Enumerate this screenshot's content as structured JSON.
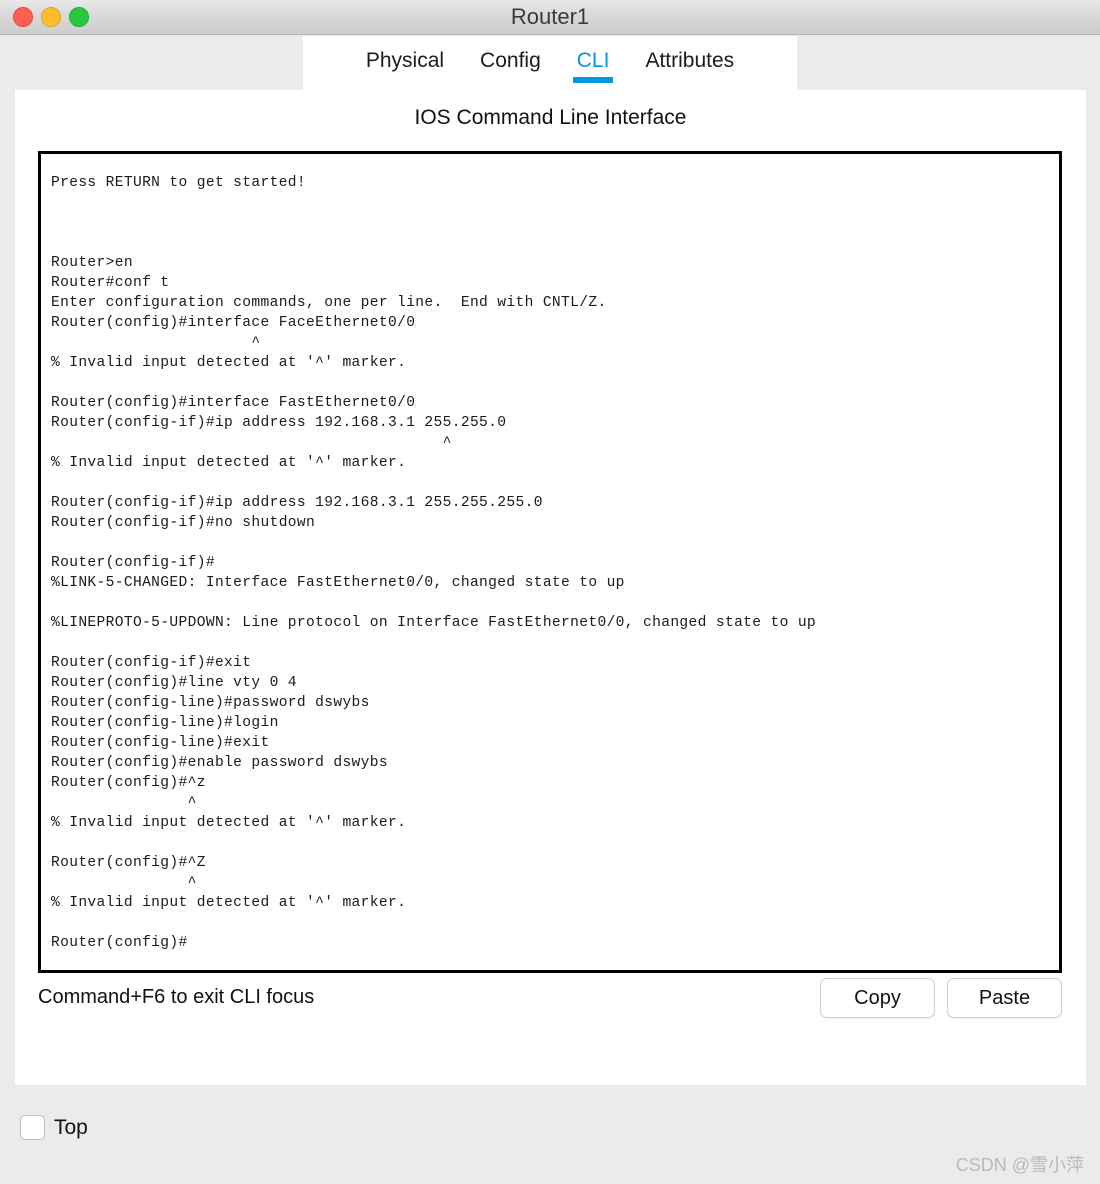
{
  "window": {
    "title": "Router1",
    "controls": [
      {
        "name": "close",
        "color": "#ff5f52"
      },
      {
        "name": "minimize",
        "color": "#ffbd2e"
      },
      {
        "name": "zoom",
        "color": "#28c93f"
      }
    ]
  },
  "tabs": [
    {
      "label": "Physical",
      "active": false
    },
    {
      "label": "Config",
      "active": false
    },
    {
      "label": "CLI",
      "active": true
    },
    {
      "label": "Attributes",
      "active": false
    }
  ],
  "accent_color": "#0099dd",
  "panel": {
    "heading": "IOS Command Line Interface"
  },
  "terminal": {
    "lines": [
      "Press RETURN to get started!",
      "",
      "",
      "",
      "Router>en",
      "Router#conf t",
      "Enter configuration commands, one per line.  End with CNTL/Z.",
      "Router(config)#interface FaceEthernet0/0",
      "                      ^",
      "% Invalid input detected at '^' marker.",
      "",
      "Router(config)#interface FastEthernet0/0",
      "Router(config-if)#ip address 192.168.3.1 255.255.0",
      "                                           ^",
      "% Invalid input detected at '^' marker.",
      "",
      "Router(config-if)#ip address 192.168.3.1 255.255.255.0",
      "Router(config-if)#no shutdown",
      "",
      "Router(config-if)#",
      "%LINK-5-CHANGED: Interface FastEthernet0/0, changed state to up",
      "",
      "%LINEPROTO-5-UPDOWN: Line protocol on Interface FastEthernet0/0, changed state to up",
      "",
      "Router(config-if)#exit",
      "Router(config)#line vty 0 4",
      "Router(config-line)#password dswybs",
      "Router(config-line)#login",
      "Router(config-line)#exit",
      "Router(config)#enable password dswybs",
      "Router(config)#^z",
      "               ^",
      "% Invalid input detected at '^' marker.",
      "",
      "Router(config)#^Z",
      "               ^",
      "% Invalid input detected at '^' marker.",
      "",
      "Router(config)#"
    ]
  },
  "footer": {
    "focus_hint": "Command+F6 to exit CLI focus",
    "copy_label": "Copy",
    "paste_label": "Paste"
  },
  "bottom": {
    "top_label": "Top",
    "top_checked": false
  },
  "watermark": "CSDN @雪小萍"
}
